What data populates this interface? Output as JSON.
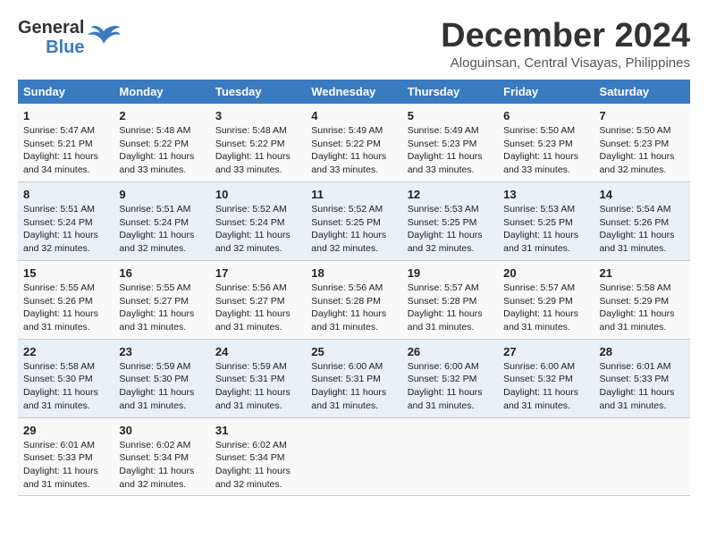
{
  "header": {
    "logo_line1": "General",
    "logo_line2": "Blue",
    "month": "December 2024",
    "location": "Aloguinsan, Central Visayas, Philippines"
  },
  "days_of_week": [
    "Sunday",
    "Monday",
    "Tuesday",
    "Wednesday",
    "Thursday",
    "Friday",
    "Saturday"
  ],
  "weeks": [
    [
      {
        "day": "1",
        "sunrise": "5:47 AM",
        "sunset": "5:21 PM",
        "daylight": "11 hours and 34 minutes."
      },
      {
        "day": "2",
        "sunrise": "5:48 AM",
        "sunset": "5:22 PM",
        "daylight": "11 hours and 33 minutes."
      },
      {
        "day": "3",
        "sunrise": "5:48 AM",
        "sunset": "5:22 PM",
        "daylight": "11 hours and 33 minutes."
      },
      {
        "day": "4",
        "sunrise": "5:49 AM",
        "sunset": "5:22 PM",
        "daylight": "11 hours and 33 minutes."
      },
      {
        "day": "5",
        "sunrise": "5:49 AM",
        "sunset": "5:23 PM",
        "daylight": "11 hours and 33 minutes."
      },
      {
        "day": "6",
        "sunrise": "5:50 AM",
        "sunset": "5:23 PM",
        "daylight": "11 hours and 33 minutes."
      },
      {
        "day": "7",
        "sunrise": "5:50 AM",
        "sunset": "5:23 PM",
        "daylight": "11 hours and 32 minutes."
      }
    ],
    [
      {
        "day": "8",
        "sunrise": "5:51 AM",
        "sunset": "5:24 PM",
        "daylight": "11 hours and 32 minutes."
      },
      {
        "day": "9",
        "sunrise": "5:51 AM",
        "sunset": "5:24 PM",
        "daylight": "11 hours and 32 minutes."
      },
      {
        "day": "10",
        "sunrise": "5:52 AM",
        "sunset": "5:24 PM",
        "daylight": "11 hours and 32 minutes."
      },
      {
        "day": "11",
        "sunrise": "5:52 AM",
        "sunset": "5:25 PM",
        "daylight": "11 hours and 32 minutes."
      },
      {
        "day": "12",
        "sunrise": "5:53 AM",
        "sunset": "5:25 PM",
        "daylight": "11 hours and 32 minutes."
      },
      {
        "day": "13",
        "sunrise": "5:53 AM",
        "sunset": "5:25 PM",
        "daylight": "11 hours and 31 minutes."
      },
      {
        "day": "14",
        "sunrise": "5:54 AM",
        "sunset": "5:26 PM",
        "daylight": "11 hours and 31 minutes."
      }
    ],
    [
      {
        "day": "15",
        "sunrise": "5:55 AM",
        "sunset": "5:26 PM",
        "daylight": "11 hours and 31 minutes."
      },
      {
        "day": "16",
        "sunrise": "5:55 AM",
        "sunset": "5:27 PM",
        "daylight": "11 hours and 31 minutes."
      },
      {
        "day": "17",
        "sunrise": "5:56 AM",
        "sunset": "5:27 PM",
        "daylight": "11 hours and 31 minutes."
      },
      {
        "day": "18",
        "sunrise": "5:56 AM",
        "sunset": "5:28 PM",
        "daylight": "11 hours and 31 minutes."
      },
      {
        "day": "19",
        "sunrise": "5:57 AM",
        "sunset": "5:28 PM",
        "daylight": "11 hours and 31 minutes."
      },
      {
        "day": "20",
        "sunrise": "5:57 AM",
        "sunset": "5:29 PM",
        "daylight": "11 hours and 31 minutes."
      },
      {
        "day": "21",
        "sunrise": "5:58 AM",
        "sunset": "5:29 PM",
        "daylight": "11 hours and 31 minutes."
      }
    ],
    [
      {
        "day": "22",
        "sunrise": "5:58 AM",
        "sunset": "5:30 PM",
        "daylight": "11 hours and 31 minutes."
      },
      {
        "day": "23",
        "sunrise": "5:59 AM",
        "sunset": "5:30 PM",
        "daylight": "11 hours and 31 minutes."
      },
      {
        "day": "24",
        "sunrise": "5:59 AM",
        "sunset": "5:31 PM",
        "daylight": "11 hours and 31 minutes."
      },
      {
        "day": "25",
        "sunrise": "6:00 AM",
        "sunset": "5:31 PM",
        "daylight": "11 hours and 31 minutes."
      },
      {
        "day": "26",
        "sunrise": "6:00 AM",
        "sunset": "5:32 PM",
        "daylight": "11 hours and 31 minutes."
      },
      {
        "day": "27",
        "sunrise": "6:00 AM",
        "sunset": "5:32 PM",
        "daylight": "11 hours and 31 minutes."
      },
      {
        "day": "28",
        "sunrise": "6:01 AM",
        "sunset": "5:33 PM",
        "daylight": "11 hours and 31 minutes."
      }
    ],
    [
      {
        "day": "29",
        "sunrise": "6:01 AM",
        "sunset": "5:33 PM",
        "daylight": "11 hours and 31 minutes."
      },
      {
        "day": "30",
        "sunrise": "6:02 AM",
        "sunset": "5:34 PM",
        "daylight": "11 hours and 32 minutes."
      },
      {
        "day": "31",
        "sunrise": "6:02 AM",
        "sunset": "5:34 PM",
        "daylight": "11 hours and 32 minutes."
      },
      null,
      null,
      null,
      null
    ]
  ]
}
